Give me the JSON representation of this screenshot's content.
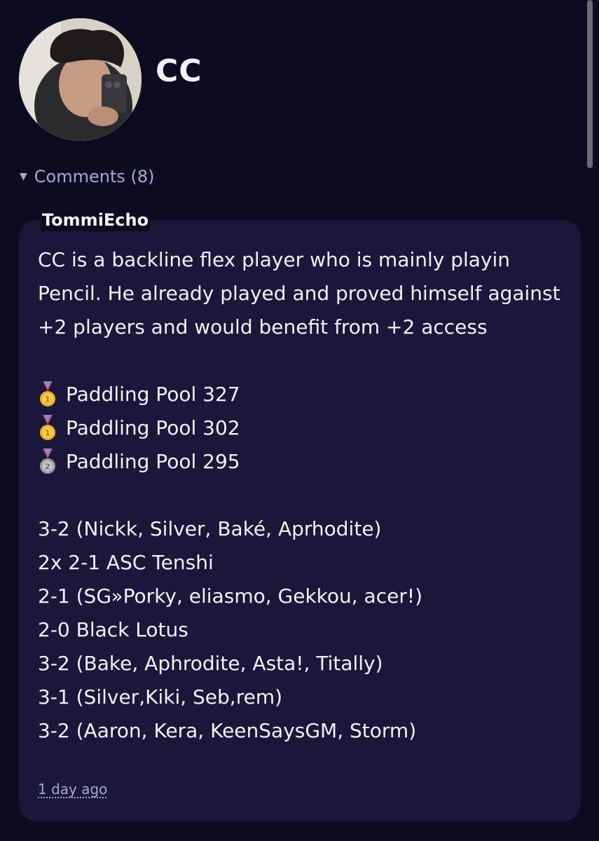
{
  "profile": {
    "name": "CC"
  },
  "comments": {
    "toggle_label": "Comments (8)",
    "items": [
      {
        "author": "TommiEcho",
        "intro": "CC is a backline flex player who is mainly playin Pencil. He already played and proved himself against +2 players and would benefit from +2 access",
        "placements": [
          {
            "medal": "gold",
            "text": "Paddling Pool 327"
          },
          {
            "medal": "gold",
            "text": "Paddling Pool 302"
          },
          {
            "medal": "silver",
            "text": "Paddling Pool 295"
          }
        ],
        "results": [
          "3-2 (Nickk, Silver, Baké, Aprhodite)",
          "2x 2-1 ASC Tenshi",
          "2-1 (SG»Porky, eliasmo, Gekkou, acer!)",
          "2-0 Black Lotus",
          "3-2 (Bake, Aphrodite, Asta!, Titally)",
          "3-1 (Silver,Kiki, Seb,rem)",
          "3-2 (Aaron, Kera, KeenSaysGM, Storm)"
        ],
        "time": "1 day ago"
      }
    ]
  },
  "colors": {
    "background": "#0c0b1f",
    "card": "#1a173b",
    "accent": "#a8a6d8",
    "text": "#f1f0f7"
  },
  "icons": {
    "caret": "caret-down-icon",
    "gold_medal": "gold-medal-icon",
    "silver_medal": "silver-medal-icon"
  }
}
